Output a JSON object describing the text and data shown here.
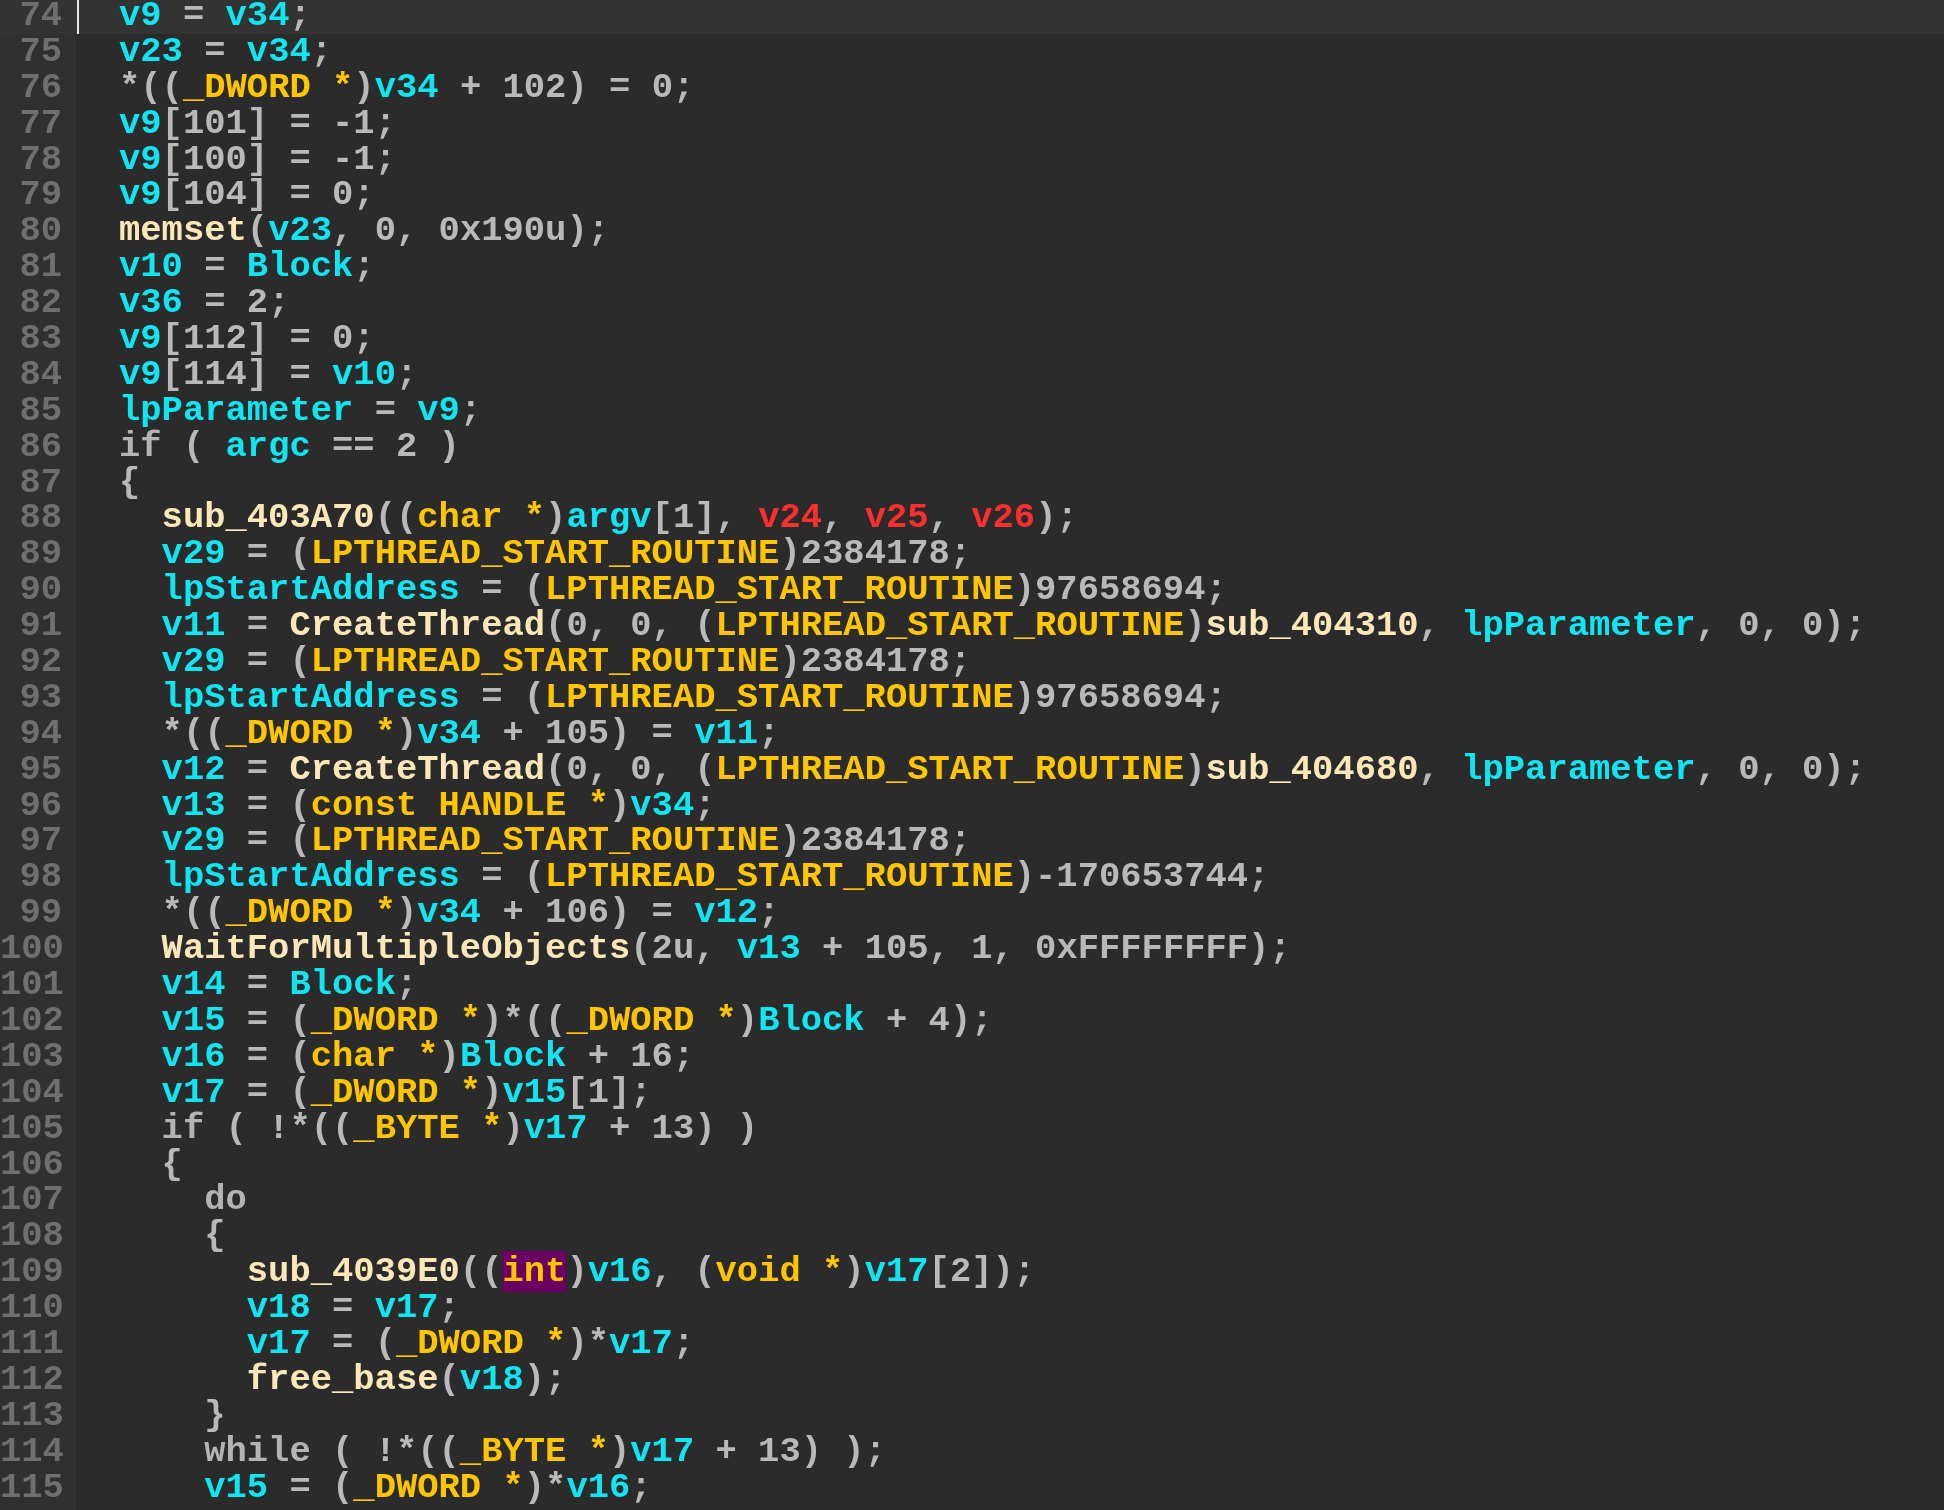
{
  "lines": [
    {
      "number": "74",
      "current": true,
      "tokens": [
        {
          "kind": "var",
          "text": "v9"
        },
        {
          "kind": "plain",
          "text": " = "
        },
        {
          "kind": "var",
          "text": "v34"
        },
        {
          "kind": "plain",
          "text": ";"
        }
      ]
    },
    {
      "number": "75",
      "current": false,
      "tokens": [
        {
          "kind": "var",
          "text": "v23"
        },
        {
          "kind": "plain",
          "text": " = "
        },
        {
          "kind": "var",
          "text": "v34"
        },
        {
          "kind": "plain",
          "text": ";"
        }
      ]
    },
    {
      "number": "76",
      "current": false,
      "tokens": [
        {
          "kind": "plain",
          "text": "*(("
        },
        {
          "kind": "type",
          "text": "_DWORD *"
        },
        {
          "kind": "plain",
          "text": ")"
        },
        {
          "kind": "var",
          "text": "v34"
        },
        {
          "kind": "plain",
          "text": " + 102) = 0;"
        }
      ]
    },
    {
      "number": "77",
      "current": false,
      "tokens": [
        {
          "kind": "var",
          "text": "v9"
        },
        {
          "kind": "plain",
          "text": "[101] = -1;"
        }
      ]
    },
    {
      "number": "78",
      "current": false,
      "tokens": [
        {
          "kind": "var",
          "text": "v9"
        },
        {
          "kind": "plain",
          "text": "[100] = -1;"
        }
      ]
    },
    {
      "number": "79",
      "current": false,
      "tokens": [
        {
          "kind": "var",
          "text": "v9"
        },
        {
          "kind": "plain",
          "text": "[104] = 0;"
        }
      ]
    },
    {
      "number": "80",
      "current": false,
      "tokens": [
        {
          "kind": "func",
          "text": "memset"
        },
        {
          "kind": "plain",
          "text": "("
        },
        {
          "kind": "var",
          "text": "v23"
        },
        {
          "kind": "plain",
          "text": ", 0, 0x190u);"
        }
      ]
    },
    {
      "number": "81",
      "current": false,
      "tokens": [
        {
          "kind": "var",
          "text": "v10"
        },
        {
          "kind": "plain",
          "text": " = "
        },
        {
          "kind": "var",
          "text": "Block"
        },
        {
          "kind": "plain",
          "text": ";"
        }
      ]
    },
    {
      "number": "82",
      "current": false,
      "tokens": [
        {
          "kind": "var",
          "text": "v36"
        },
        {
          "kind": "plain",
          "text": " = 2;"
        }
      ]
    },
    {
      "number": "83",
      "current": false,
      "tokens": [
        {
          "kind": "var",
          "text": "v9"
        },
        {
          "kind": "plain",
          "text": "[112] = 0;"
        }
      ]
    },
    {
      "number": "84",
      "current": false,
      "tokens": [
        {
          "kind": "var",
          "text": "v9"
        },
        {
          "kind": "plain",
          "text": "[114] = "
        },
        {
          "kind": "var",
          "text": "v10"
        },
        {
          "kind": "plain",
          "text": ";"
        }
      ]
    },
    {
      "number": "85",
      "current": false,
      "tokens": [
        {
          "kind": "var",
          "text": "lpParameter"
        },
        {
          "kind": "plain",
          "text": " = "
        },
        {
          "kind": "var",
          "text": "v9"
        },
        {
          "kind": "plain",
          "text": ";"
        }
      ]
    },
    {
      "number": "86",
      "current": false,
      "tokens": [
        {
          "kind": "keyword",
          "text": "if"
        },
        {
          "kind": "plain",
          "text": " ( "
        },
        {
          "kind": "var",
          "text": "argc"
        },
        {
          "kind": "plain",
          "text": " == 2 )"
        }
      ]
    },
    {
      "number": "87",
      "current": false,
      "tokens": [
        {
          "kind": "plain",
          "text": "{"
        }
      ],
      "children": [
        {
          "number": "88",
          "current": false,
          "tokens": [
            {
              "kind": "func",
              "text": "sub_403A70"
            },
            {
              "kind": "plain",
              "text": "(("
            },
            {
              "kind": "type",
              "text": "char *"
            },
            {
              "kind": "plain",
              "text": ")"
            },
            {
              "kind": "var",
              "text": "argv"
            },
            {
              "kind": "plain",
              "text": "[1], "
            },
            {
              "kind": "undef",
              "text": "v24"
            },
            {
              "kind": "plain",
              "text": ", "
            },
            {
              "kind": "undef",
              "text": "v25"
            },
            {
              "kind": "plain",
              "text": ", "
            },
            {
              "kind": "undef",
              "text": "v26"
            },
            {
              "kind": "plain",
              "text": ");"
            }
          ]
        },
        {
          "number": "89",
          "current": false,
          "tokens": [
            {
              "kind": "var",
              "text": "v29"
            },
            {
              "kind": "plain",
              "text": " = ("
            },
            {
              "kind": "type",
              "text": "LPTHREAD_START_ROUTINE"
            },
            {
              "kind": "plain",
              "text": ")2384178;"
            }
          ]
        },
        {
          "number": "90",
          "current": false,
          "tokens": [
            {
              "kind": "var",
              "text": "lpStartAddress"
            },
            {
              "kind": "plain",
              "text": " = ("
            },
            {
              "kind": "type",
              "text": "LPTHREAD_START_ROUTINE"
            },
            {
              "kind": "plain",
              "text": ")97658694;"
            }
          ]
        },
        {
          "number": "91",
          "current": false,
          "tokens": [
            {
              "kind": "var",
              "text": "v11"
            },
            {
              "kind": "plain",
              "text": " = "
            },
            {
              "kind": "func",
              "text": "CreateThread"
            },
            {
              "kind": "plain",
              "text": "(0, 0, ("
            },
            {
              "kind": "type",
              "text": "LPTHREAD_START_ROUTINE"
            },
            {
              "kind": "plain",
              "text": ")"
            },
            {
              "kind": "func",
              "text": "sub_404310"
            },
            {
              "kind": "plain",
              "text": ", "
            },
            {
              "kind": "var",
              "text": "lpParameter"
            },
            {
              "kind": "plain",
              "text": ", 0, 0);"
            }
          ]
        },
        {
          "number": "92",
          "current": false,
          "tokens": [
            {
              "kind": "var",
              "text": "v29"
            },
            {
              "kind": "plain",
              "text": " = ("
            },
            {
              "kind": "type",
              "text": "LPTHREAD_START_ROUTINE"
            },
            {
              "kind": "plain",
              "text": ")2384178;"
            }
          ]
        },
        {
          "number": "93",
          "current": false,
          "tokens": [
            {
              "kind": "var",
              "text": "lpStartAddress"
            },
            {
              "kind": "plain",
              "text": " = ("
            },
            {
              "kind": "type",
              "text": "LPTHREAD_START_ROUTINE"
            },
            {
              "kind": "plain",
              "text": ")97658694;"
            }
          ]
        },
        {
          "number": "94",
          "current": false,
          "tokens": [
            {
              "kind": "plain",
              "text": "*(("
            },
            {
              "kind": "type",
              "text": "_DWORD *"
            },
            {
              "kind": "plain",
              "text": ")"
            },
            {
              "kind": "var",
              "text": "v34"
            },
            {
              "kind": "plain",
              "text": " + 105) = "
            },
            {
              "kind": "var",
              "text": "v11"
            },
            {
              "kind": "plain",
              "text": ";"
            }
          ]
        },
        {
          "number": "95",
          "current": false,
          "tokens": [
            {
              "kind": "var",
              "text": "v12"
            },
            {
              "kind": "plain",
              "text": " = "
            },
            {
              "kind": "func",
              "text": "CreateThread"
            },
            {
              "kind": "plain",
              "text": "(0, 0, ("
            },
            {
              "kind": "type",
              "text": "LPTHREAD_START_ROUTINE"
            },
            {
              "kind": "plain",
              "text": ")"
            },
            {
              "kind": "func",
              "text": "sub_404680"
            },
            {
              "kind": "plain",
              "text": ", "
            },
            {
              "kind": "var",
              "text": "lpParameter"
            },
            {
              "kind": "plain",
              "text": ", 0, 0);"
            }
          ]
        },
        {
          "number": "96",
          "current": false,
          "tokens": [
            {
              "kind": "var",
              "text": "v13"
            },
            {
              "kind": "plain",
              "text": " = ("
            },
            {
              "kind": "type",
              "text": "const HANDLE *"
            },
            {
              "kind": "plain",
              "text": ")"
            },
            {
              "kind": "var",
              "text": "v34"
            },
            {
              "kind": "plain",
              "text": ";"
            }
          ]
        },
        {
          "number": "97",
          "current": false,
          "tokens": [
            {
              "kind": "var",
              "text": "v29"
            },
            {
              "kind": "plain",
              "text": " = ("
            },
            {
              "kind": "type",
              "text": "LPTHREAD_START_ROUTINE"
            },
            {
              "kind": "plain",
              "text": ")2384178;"
            }
          ]
        },
        {
          "number": "98",
          "current": false,
          "tokens": [
            {
              "kind": "var",
              "text": "lpStartAddress"
            },
            {
              "kind": "plain",
              "text": " = ("
            },
            {
              "kind": "type",
              "text": "LPTHREAD_START_ROUTINE"
            },
            {
              "kind": "plain",
              "text": ")-170653744;"
            }
          ]
        },
        {
          "number": "99",
          "current": false,
          "tokens": [
            {
              "kind": "plain",
              "text": "*(("
            },
            {
              "kind": "type",
              "text": "_DWORD *"
            },
            {
              "kind": "plain",
              "text": ")"
            },
            {
              "kind": "var",
              "text": "v34"
            },
            {
              "kind": "plain",
              "text": " + 106) = "
            },
            {
              "kind": "var",
              "text": "v12"
            },
            {
              "kind": "plain",
              "text": ";"
            }
          ]
        },
        {
          "number": "100",
          "current": false,
          "tokens": [
            {
              "kind": "func",
              "text": "WaitForMultipleObjects"
            },
            {
              "kind": "plain",
              "text": "(2u, "
            },
            {
              "kind": "var",
              "text": "v13"
            },
            {
              "kind": "plain",
              "text": " + 105, 1, 0xFFFFFFFF);"
            }
          ]
        },
        {
          "number": "101",
          "current": false,
          "tokens": [
            {
              "kind": "var",
              "text": "v14"
            },
            {
              "kind": "plain",
              "text": " = "
            },
            {
              "kind": "var",
              "text": "Block"
            },
            {
              "kind": "plain",
              "text": ";"
            }
          ]
        },
        {
          "number": "102",
          "current": false,
          "tokens": [
            {
              "kind": "var",
              "text": "v15"
            },
            {
              "kind": "plain",
              "text": " = ("
            },
            {
              "kind": "type",
              "text": "_DWORD *"
            },
            {
              "kind": "plain",
              "text": ")*(("
            },
            {
              "kind": "type",
              "text": "_DWORD *"
            },
            {
              "kind": "plain",
              "text": ")"
            },
            {
              "kind": "var",
              "text": "Block"
            },
            {
              "kind": "plain",
              "text": " + 4);"
            }
          ]
        },
        {
          "number": "103",
          "current": false,
          "tokens": [
            {
              "kind": "var",
              "text": "v16"
            },
            {
              "kind": "plain",
              "text": " = ("
            },
            {
              "kind": "type",
              "text": "char *"
            },
            {
              "kind": "plain",
              "text": ")"
            },
            {
              "kind": "var",
              "text": "Block"
            },
            {
              "kind": "plain",
              "text": " + 16;"
            }
          ]
        },
        {
          "number": "104",
          "current": false,
          "tokens": [
            {
              "kind": "var",
              "text": "v17"
            },
            {
              "kind": "plain",
              "text": " = ("
            },
            {
              "kind": "type",
              "text": "_DWORD *"
            },
            {
              "kind": "plain",
              "text": ")"
            },
            {
              "kind": "var",
              "text": "v15"
            },
            {
              "kind": "plain",
              "text": "[1];"
            }
          ]
        },
        {
          "number": "105",
          "current": false,
          "tokens": [
            {
              "kind": "keyword",
              "text": "if"
            },
            {
              "kind": "plain",
              "text": " ( !*(("
            },
            {
              "kind": "type",
              "text": "_BYTE *"
            },
            {
              "kind": "plain",
              "text": ")"
            },
            {
              "kind": "var",
              "text": "v17"
            },
            {
              "kind": "plain",
              "text": " + 13) )"
            }
          ]
        },
        {
          "number": "106",
          "current": false,
          "tokens": [
            {
              "kind": "plain",
              "text": "{"
            }
          ],
          "children": [
            {
              "number": "107",
              "current": false,
              "tokens": [
                {
                  "kind": "keyword",
                  "text": "do"
                }
              ]
            },
            {
              "number": "108",
              "current": false,
              "tokens": [
                {
                  "kind": "plain",
                  "text": "{"
                }
              ],
              "children": [
                {
                  "number": "109",
                  "current": false,
                  "tokens": [
                    {
                      "kind": "func",
                      "text": "sub_4039E0"
                    },
                    {
                      "kind": "plain",
                      "text": "(("
                    },
                    {
                      "kind": "marked",
                      "text": "int"
                    },
                    {
                      "kind": "plain",
                      "text": ")"
                    },
                    {
                      "kind": "var",
                      "text": "v16"
                    },
                    {
                      "kind": "plain",
                      "text": ", ("
                    },
                    {
                      "kind": "type",
                      "text": "void *"
                    },
                    {
                      "kind": "plain",
                      "text": ")"
                    },
                    {
                      "kind": "var",
                      "text": "v17"
                    },
                    {
                      "kind": "plain",
                      "text": "[2]);"
                    }
                  ]
                },
                {
                  "number": "110",
                  "current": false,
                  "tokens": [
                    {
                      "kind": "var",
                      "text": "v18"
                    },
                    {
                      "kind": "plain",
                      "text": " = "
                    },
                    {
                      "kind": "var",
                      "text": "v17"
                    },
                    {
                      "kind": "plain",
                      "text": ";"
                    }
                  ]
                },
                {
                  "number": "111",
                  "current": false,
                  "tokens": [
                    {
                      "kind": "var",
                      "text": "v17"
                    },
                    {
                      "kind": "plain",
                      "text": " = ("
                    },
                    {
                      "kind": "type",
                      "text": "_DWORD *"
                    },
                    {
                      "kind": "plain",
                      "text": ")*"
                    },
                    {
                      "kind": "var",
                      "text": "v17"
                    },
                    {
                      "kind": "plain",
                      "text": ";"
                    }
                  ]
                },
                {
                  "number": "112",
                  "current": false,
                  "tokens": [
                    {
                      "kind": "func",
                      "text": "free_base"
                    },
                    {
                      "kind": "plain",
                      "text": "("
                    },
                    {
                      "kind": "var",
                      "text": "v18"
                    },
                    {
                      "kind": "plain",
                      "text": ");"
                    }
                  ]
                }
              ]
            },
            {
              "number": "113",
              "current": false,
              "tokens": [
                {
                  "kind": "plain",
                  "text": "}"
                }
              ]
            },
            {
              "number": "114",
              "current": false,
              "tokens": [
                {
                  "kind": "keyword",
                  "text": "while"
                },
                {
                  "kind": "plain",
                  "text": " ( !*(("
                },
                {
                  "kind": "type",
                  "text": "_BYTE *"
                },
                {
                  "kind": "plain",
                  "text": ")"
                },
                {
                  "kind": "var",
                  "text": "v17"
                },
                {
                  "kind": "plain",
                  "text": " + 13) );"
                }
              ]
            },
            {
              "number": "115",
              "current": false,
              "tokens": [
                {
                  "kind": "var",
                  "text": "v15"
                },
                {
                  "kind": "plain",
                  "text": " = ("
                },
                {
                  "kind": "type",
                  "text": "_DWORD *"
                },
                {
                  "kind": "plain",
                  "text": ")*"
                },
                {
                  "kind": "var",
                  "text": "v16"
                },
                {
                  "kind": "plain",
                  "text": ";"
                }
              ]
            }
          ]
        }
      ]
    }
  ]
}
